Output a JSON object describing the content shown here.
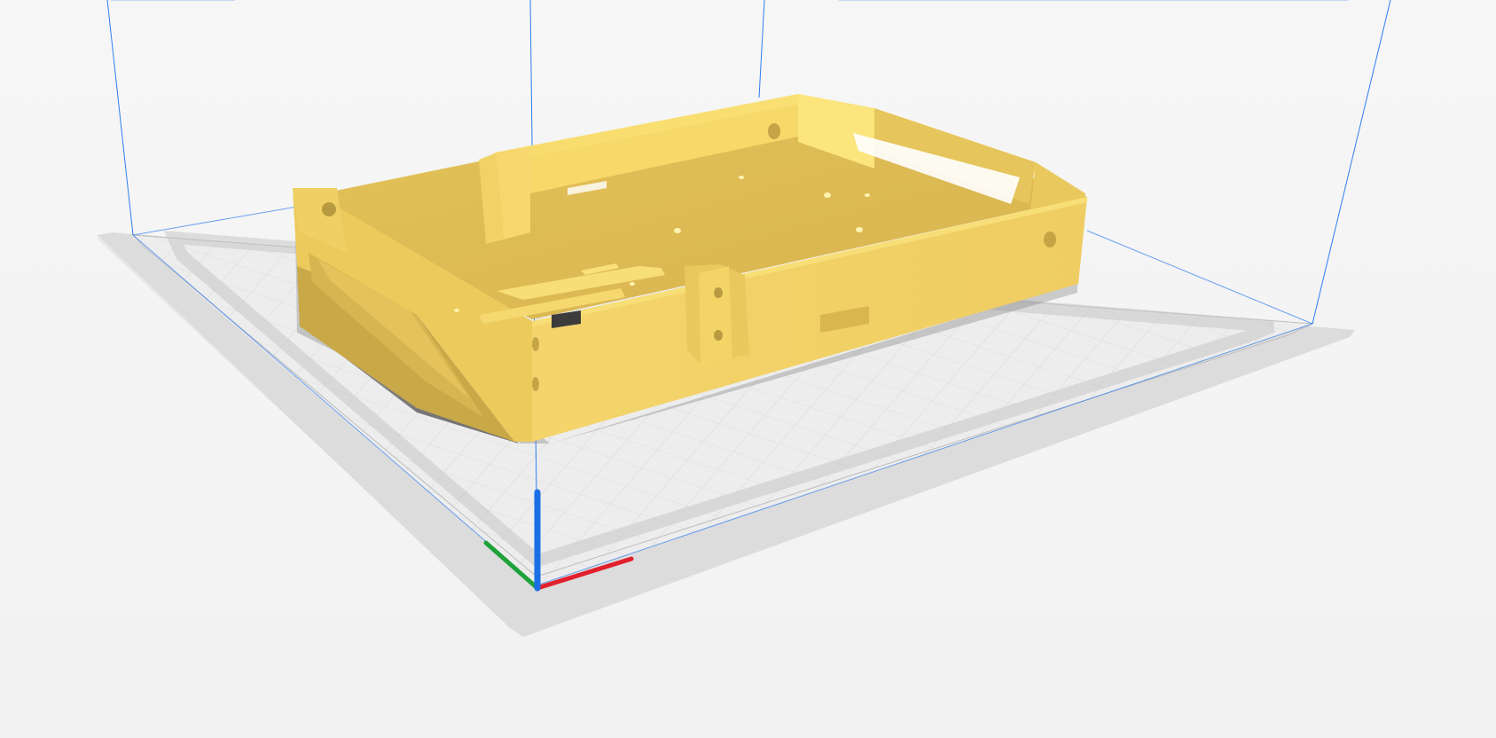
{
  "scene": {
    "background_color": "#f4f4f4",
    "build_plate_color": "#d9d9d9",
    "grid_color": "#cfcfcf",
    "model_color": "#f1cf5f",
    "model_shadow_color": "#cbb04e",
    "axis_colors": {
      "x": "#e1202d",
      "y": "#1ea23b",
      "z": "#1a6fe6"
    },
    "volume_line_color": "#2d7ef0"
  },
  "icons": [
    "build-plate",
    "printable-volume-outline",
    "3d-model",
    "axis-gizmo"
  ]
}
